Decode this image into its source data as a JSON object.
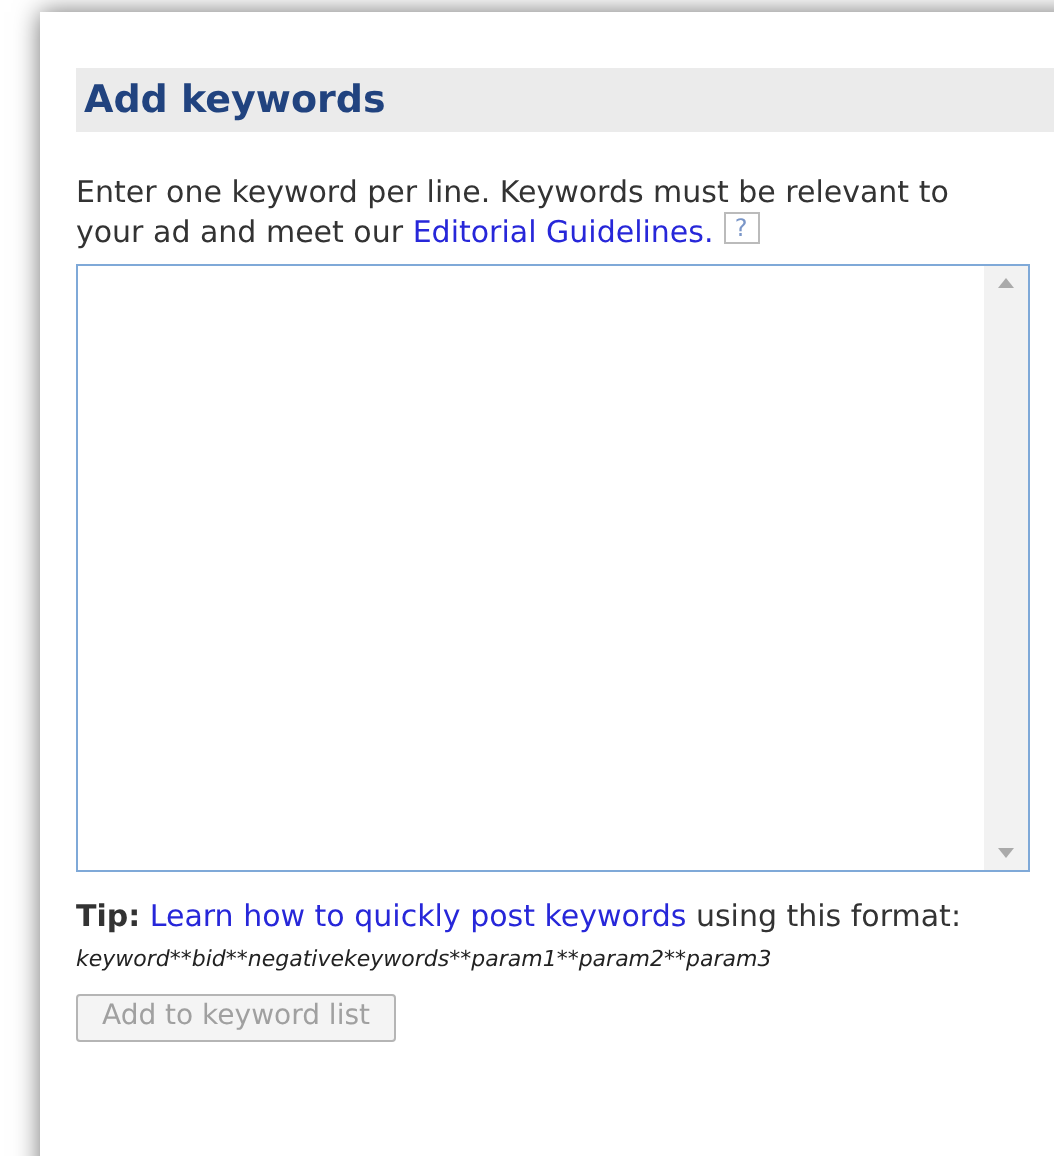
{
  "panel": {
    "title": "Add keywords",
    "instructions": {
      "text": "Enter one keyword per line. Keywords must be relevant to your ad and meet our",
      "link": "Editorial Guidelines.",
      "help": "?"
    },
    "tip": {
      "prefix": "**Tip:**",
      "link": "Learn how to quickly post keywords",
      "suffix": "using this format:"
    },
    "format": "keyword**bid**negativekeywords**param1**param2**param3",
    "button": {
      "label": "Add to keyword list",
      "disabled": true
    }
  }
}
